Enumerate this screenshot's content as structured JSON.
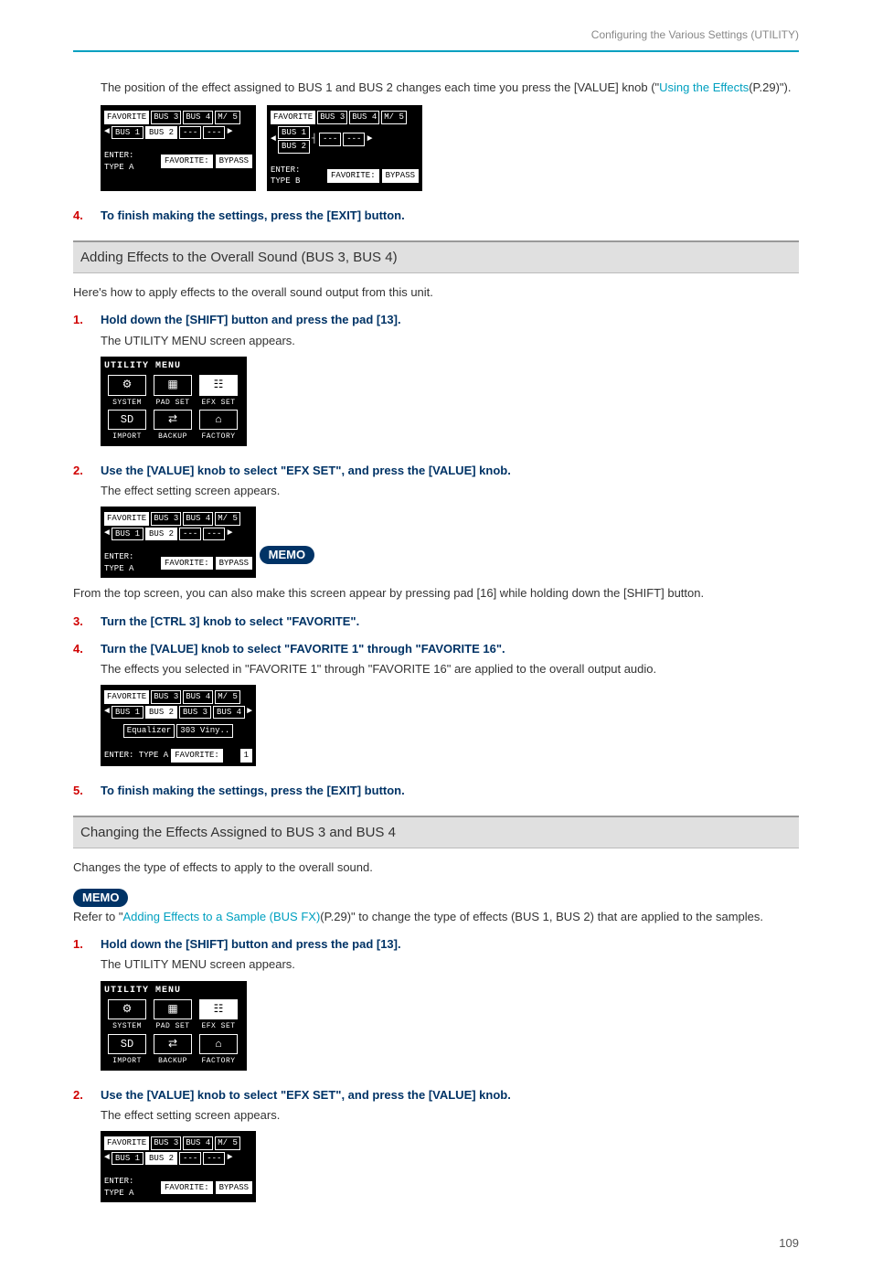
{
  "header": {
    "title": "Configuring the Various Settings (UTILITY)"
  },
  "intro": {
    "text_before_link": "The position of the effect assigned to BUS 1 and BUS 2 changes each time you press the [VALUE] knob (\"",
    "link_text": "Using the Effects",
    "text_after_link": "(P.29)\")."
  },
  "ss_bus": {
    "tab_favorite": "FAVORITE",
    "tab_bus3": "BUS 3",
    "tab_bus4": "BUS 4",
    "tab_m5a": "M/ 5",
    "tab_m5b": "M/ 5",
    "bus1": "BUS 1",
    "bus2": "BUS 2",
    "bus3": "BUS 3",
    "bus4": "BUS 4",
    "sep": "---",
    "enter_a": "ENTER: TYPE A",
    "enter_b": "ENTER: TYPE B",
    "fav_label": "FAVORITE:",
    "bypass": "BYPASS",
    "eq": "Equalizer",
    "vinyl": "303 Viny..",
    "fav_num": "1"
  },
  "util": {
    "title": "UTILITY MENU",
    "icons": {
      "system": "⚙",
      "padset": "▦",
      "efxset": "☷",
      "import": "SD",
      "backup": "⇄",
      "factory": "⌂"
    },
    "labels": {
      "system": "SYSTEM",
      "padset": "PAD SET",
      "efxset": "EFX SET",
      "import": "IMPORT",
      "backup": "BACKUP",
      "factory": "FACTORY"
    }
  },
  "step_top_4": {
    "num": "4.",
    "text": "To finish making the settings, press the [EXIT] button."
  },
  "section1": {
    "title": "Adding Effects to the Overall Sound (BUS 3, BUS 4)",
    "intro": "Here's how to apply effects to the overall sound output from this unit.",
    "steps": {
      "s1": {
        "num": "1.",
        "text": "Hold down the [SHIFT] button and press the pad [13].",
        "sub": "The UTILITY MENU screen appears."
      },
      "s2": {
        "num": "2.",
        "text": "Use the [VALUE] knob to select \"EFX SET\", and press the [VALUE] knob.",
        "sub": "The effect setting screen appears."
      },
      "memo": {
        "label": "MEMO",
        "text": "From the top screen, you can also make this screen appear by pressing pad [16] while holding down the [SHIFT] button."
      },
      "s3": {
        "num": "3.",
        "text": "Turn the [CTRL 3] knob to select \"FAVORITE\"."
      },
      "s4": {
        "num": "4.",
        "text": "Turn the [VALUE] knob to select \"FAVORITE 1\" through \"FAVORITE 16\".",
        "sub": "The effects you selected in \"FAVORITE 1\" through \"FAVORITE 16\" are applied to the overall output audio."
      },
      "s5": {
        "num": "5.",
        "text": "To finish making the settings, press the [EXIT] button."
      }
    }
  },
  "section2": {
    "title": "Changing the Effects Assigned to BUS 3 and BUS 4",
    "intro": "Changes the type of effects to apply to the overall sound.",
    "memo": {
      "label": "MEMO",
      "before": "Refer to \"",
      "link": "Adding Effects to a Sample (BUS FX)",
      "after": "(P.29)\" to change the type of effects (BUS 1, BUS 2) that are applied to the samples."
    },
    "steps": {
      "s1": {
        "num": "1.",
        "text": "Hold down the [SHIFT] button and press the pad [13].",
        "sub": "The UTILITY MENU screen appears."
      },
      "s2": {
        "num": "2.",
        "text": "Use the [VALUE] knob to select \"EFX SET\", and press the [VALUE] knob.",
        "sub": "The effect setting screen appears."
      }
    }
  },
  "page_number": "109"
}
